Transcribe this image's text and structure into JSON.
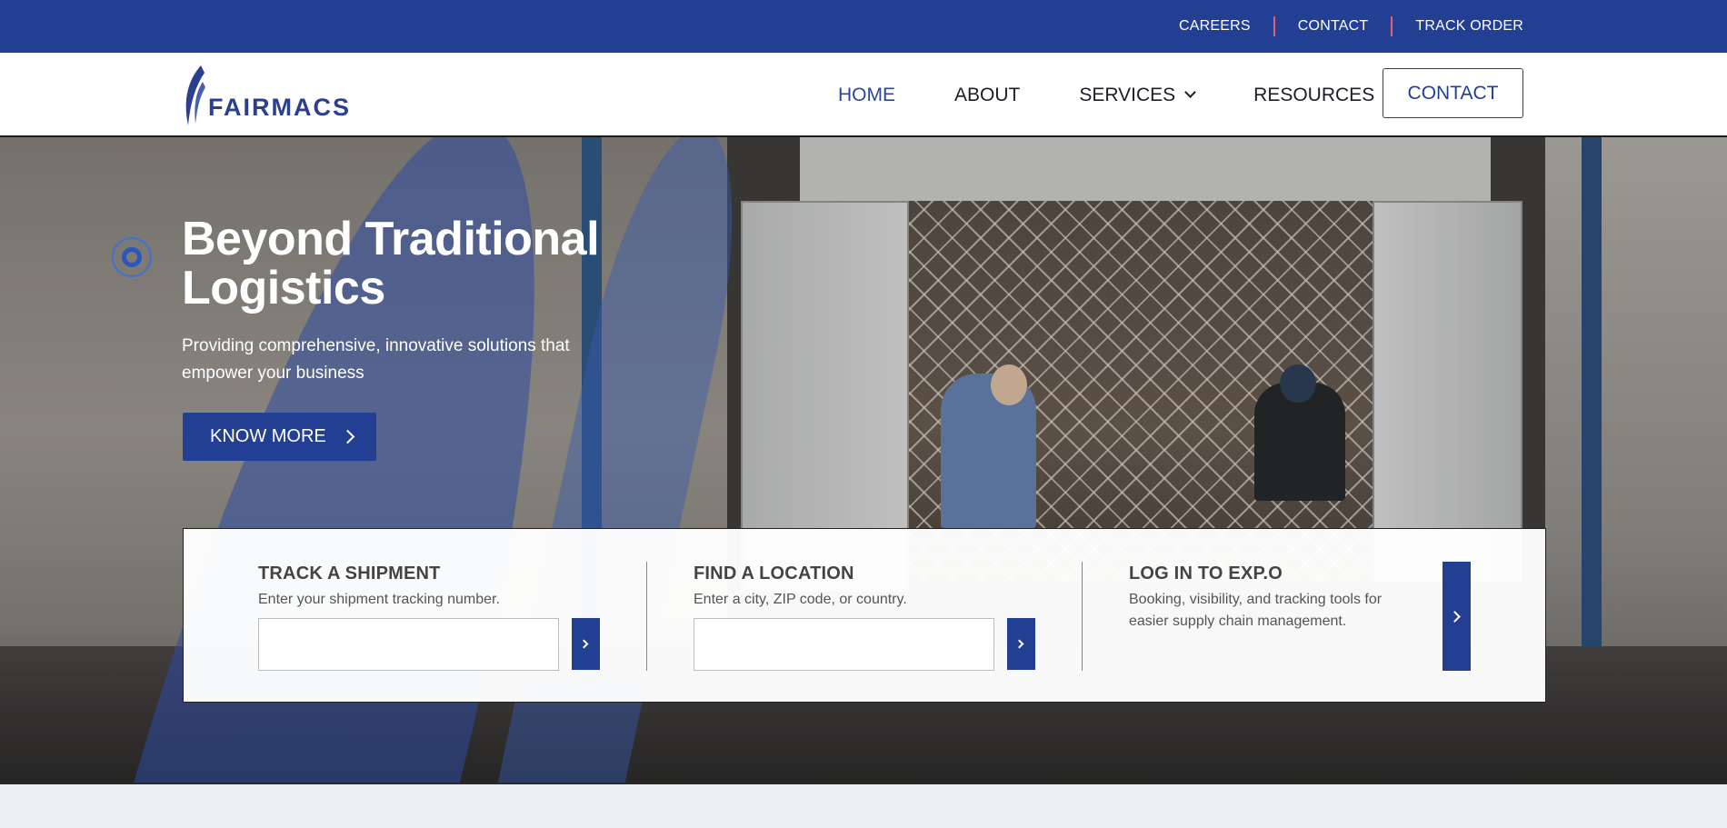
{
  "utility_links": [
    "CAREERS",
    "CONTACT",
    "TRACK ORDER"
  ],
  "brand": {
    "name": "FAIRMACS"
  },
  "nav": {
    "home": "HOME",
    "about": "ABOUT",
    "services": "SERVICES",
    "resources": "RESOURCES",
    "contact_button": "CONTACT"
  },
  "hero": {
    "title": "Beyond Traditional Logistics",
    "subtitle": "Providing comprehensive, innovative solutions that empower your business",
    "cta": "KNOW MORE"
  },
  "tools": {
    "track": {
      "title": "TRACK A SHIPMENT",
      "desc": "Enter your shipment tracking number.",
      "value": ""
    },
    "location": {
      "title": "FIND A LOCATION",
      "desc": "Enter a city, ZIP code, or country.",
      "value": ""
    },
    "expo": {
      "title": "LOG IN TO EXP.O",
      "desc_line1": "Booking, visibility, and tracking tools for",
      "desc_line2": "easier supply chain management."
    }
  },
  "colors": {
    "brand_blue": "#233f94",
    "separator": "#e0607a"
  }
}
